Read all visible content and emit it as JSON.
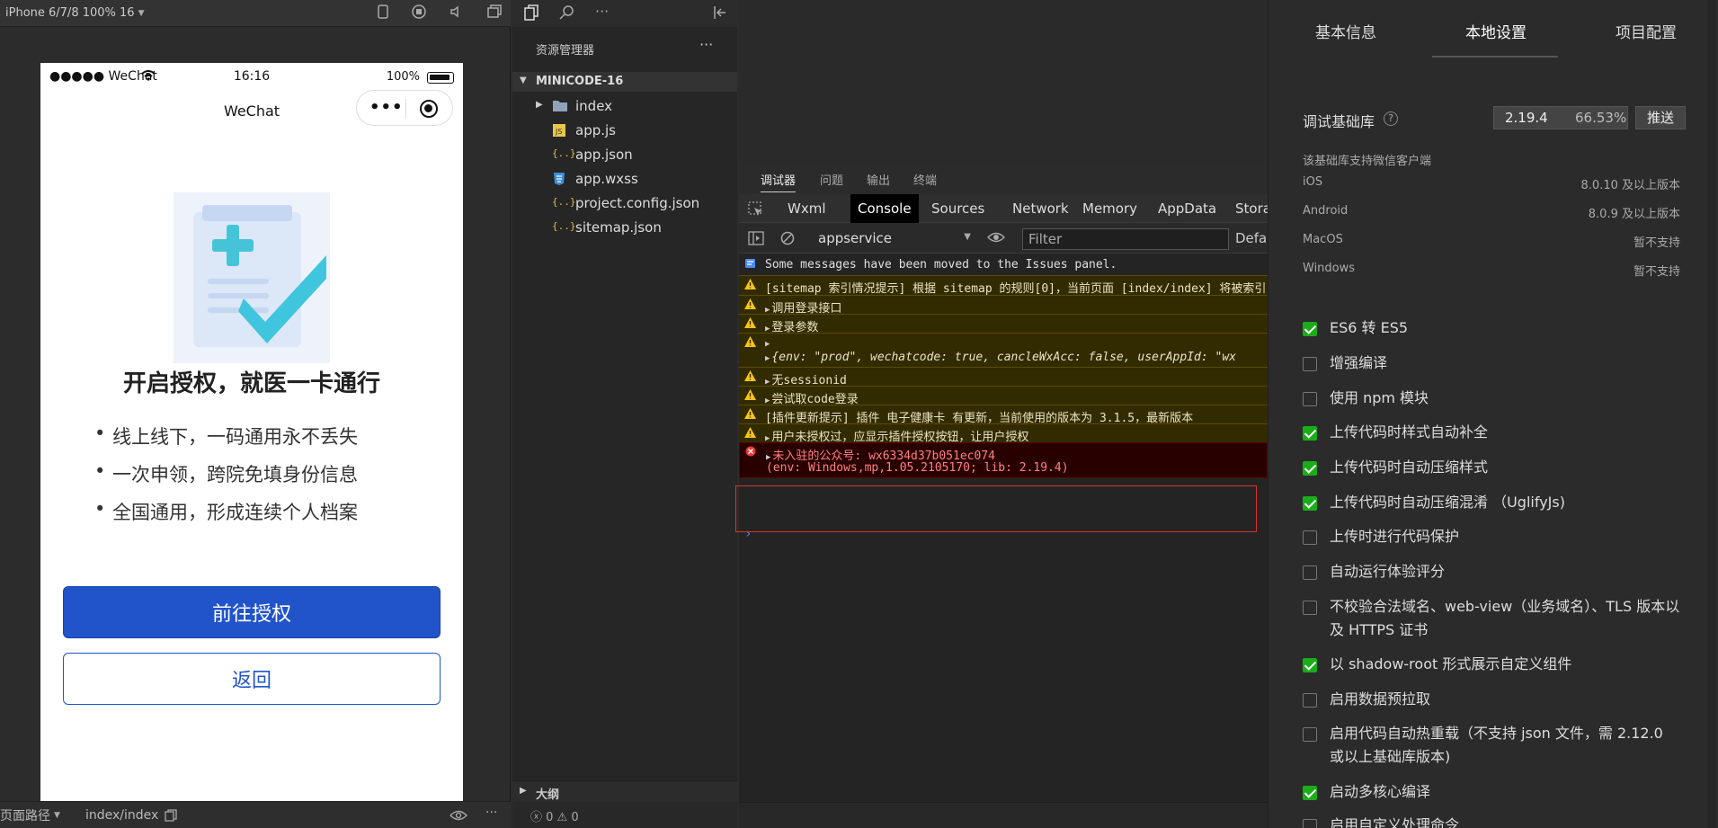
{
  "simulator": {
    "device_label": "iPhone 6/7/8 100% 16",
    "status": {
      "carrier": "●●●●● WeChat",
      "time": "16:16",
      "battery": "100%"
    },
    "nav_title": "WeChat",
    "auth_title": "开启授权，就医一卡通行",
    "features": [
      "线上线下，一码通用永不丢失",
      "一次申领，跨院免填身份信息",
      "全国通用，形成连续个人档案"
    ],
    "primary_button": "前往授权",
    "secondary_button": "返回",
    "bottom_path_label": "页面路径",
    "bottom_path_value": "index/index"
  },
  "explorer": {
    "title": "资源管理器",
    "more": "···",
    "project": "MINICODE-16",
    "files": [
      {
        "name": "index",
        "icon": "folder-icon"
      },
      {
        "name": "app.js",
        "icon": "js-file-icon"
      },
      {
        "name": "app.json",
        "icon": "json-file-icon"
      },
      {
        "name": "app.wxss",
        "icon": "css-file-icon"
      },
      {
        "name": "project.config.json",
        "icon": "json-file-icon"
      },
      {
        "name": "sitemap.json",
        "icon": "json-file-icon"
      }
    ],
    "outline": "大纲",
    "status": "ⓧ 0 ⚠ 0"
  },
  "devtools": {
    "panel_tabs": [
      "调试器",
      "问题",
      "输出",
      "终端"
    ],
    "tabs": [
      "Wxml",
      "Console",
      "Sources",
      "Network",
      "Memory",
      "AppData",
      "Stora"
    ],
    "active_tab": "Console",
    "context": "appservice",
    "filter_placeholder": "Filter",
    "levels": "Defau",
    "messages": [
      {
        "type": "info",
        "text": "Some messages have been moved to the Issues panel."
      },
      {
        "type": "warn",
        "text": "[sitemap 索引情况提示] 根据 sitemap 的规则[0]，当前页面 [index/index] 将被索引"
      },
      {
        "type": "warn",
        "text": "调用登录接口"
      },
      {
        "type": "warn",
        "text": "登录参数"
      },
      {
        "type": "warn",
        "text": "{env: \"prod\", wechatcode: true, cancleWxAcc: false, userAppId: \"wx"
      },
      {
        "type": "warn",
        "text": "无sessionid"
      },
      {
        "type": "warn",
        "text": "尝试取code登录"
      },
      {
        "type": "warn",
        "text": "[插件更新提示] 插件 电子健康卡 有更新，当前使用的版本为 3.1.5，最新版本"
      },
      {
        "type": "warn",
        "text": "用户未授权过，应显示插件授权按钮，让用户授权"
      },
      {
        "type": "error",
        "text": "未入驻的公众号: wx6334d37b051ec074",
        "text2": "(env: Windows,mp,1.05.2105170; lib: 2.19.4)"
      }
    ],
    "prompt": "›"
  },
  "settings": {
    "tabs": [
      "基本信息",
      "本地设置",
      "项目配置"
    ],
    "active_tab": "本地设置",
    "sdk_label": "调试基础库",
    "sdk_version": "2.19.4",
    "sdk_percent": "66.53%",
    "push_label": "推送",
    "support_note": "该基础库支持微信客户端",
    "platforms": [
      {
        "name": "iOS",
        "value": "8.0.10 及以上版本"
      },
      {
        "name": "Android",
        "value": "8.0.9 及以上版本"
      },
      {
        "name": "MacOS",
        "value": "暂不支持"
      },
      {
        "name": "Windows",
        "value": "暂不支持"
      }
    ],
    "options": [
      {
        "label": "ES6 转 ES5",
        "checked": true
      },
      {
        "label": "增强编译",
        "checked": false
      },
      {
        "label": "使用 npm 模块",
        "checked": false
      },
      {
        "label": "上传代码时样式自动补全",
        "checked": true
      },
      {
        "label": "上传代码时自动压缩样式",
        "checked": true
      },
      {
        "label": "上传代码时自动压缩混淆 （UglifyJs)",
        "checked": true
      },
      {
        "label": "上传时进行代码保护",
        "checked": false
      },
      {
        "label": "自动运行体验评分",
        "checked": false
      },
      {
        "label": "不校验合法域名、web-view（业务域名）、TLS 版本以及 HTTPS 证书",
        "checked": false
      },
      {
        "label": "以 shadow-root 形式展示自定义组件",
        "checked": true
      },
      {
        "label": "启用数据预拉取",
        "checked": false
      },
      {
        "label": "启用代码自动热重载（不支持 json 文件，需 2.12.0 或以上基础库版本)",
        "checked": false
      },
      {
        "label": "启动多核心编译",
        "checked": true
      },
      {
        "label": "启用自定义处理命令",
        "checked": false
      }
    ]
  }
}
